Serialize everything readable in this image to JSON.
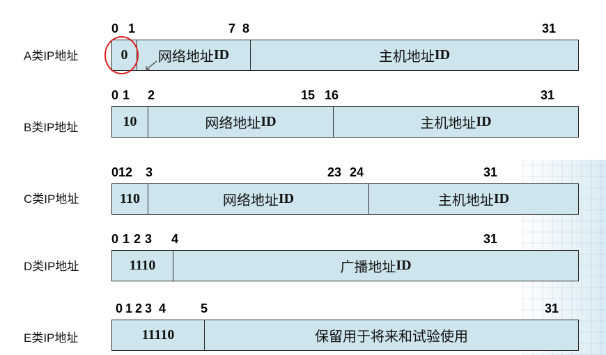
{
  "rows": [
    {
      "label": "A类IP地址",
      "bits": [
        "0",
        "1",
        "7",
        "8",
        "31"
      ],
      "segments": [
        {
          "text": "0"
        },
        {
          "text_cn": "网络地址",
          "text_id": "ID"
        },
        {
          "text_cn": "主机地址",
          "text_id": "ID"
        }
      ]
    },
    {
      "label": "B类IP地址",
      "bits": [
        "0",
        "1",
        "2",
        "15",
        "16",
        "31"
      ],
      "segments": [
        {
          "text": "10"
        },
        {
          "text_cn": "网络地址",
          "text_id": "ID"
        },
        {
          "text_cn": "主机地址",
          "text_id": "ID"
        }
      ]
    },
    {
      "label": "C类IP地址",
      "bits": [
        "0",
        "1",
        "2",
        "3",
        "23",
        "24",
        "31"
      ],
      "segments": [
        {
          "text": "110"
        },
        {
          "text_cn": "网络地址",
          "text_id": "ID"
        },
        {
          "text_cn": "主机地址",
          "text_id": "ID"
        }
      ]
    },
    {
      "label": "D类IP地址",
      "bits": [
        "0",
        "1",
        "2",
        "3",
        "4",
        "31"
      ],
      "segments": [
        {
          "text": "1110"
        },
        {
          "text_cn": "广播地址",
          "text_id": "ID"
        }
      ]
    },
    {
      "label": "E类IP地址",
      "bits": [
        "0",
        "1",
        "2",
        "3",
        "4",
        "5",
        "31"
      ],
      "segments": [
        {
          "text": "11110"
        },
        {
          "text_cn": "保留用于将来和试验使用",
          "text_id": ""
        }
      ]
    }
  ],
  "annotation_color": "#d8231e",
  "bar_color": "#cfe5ee"
}
